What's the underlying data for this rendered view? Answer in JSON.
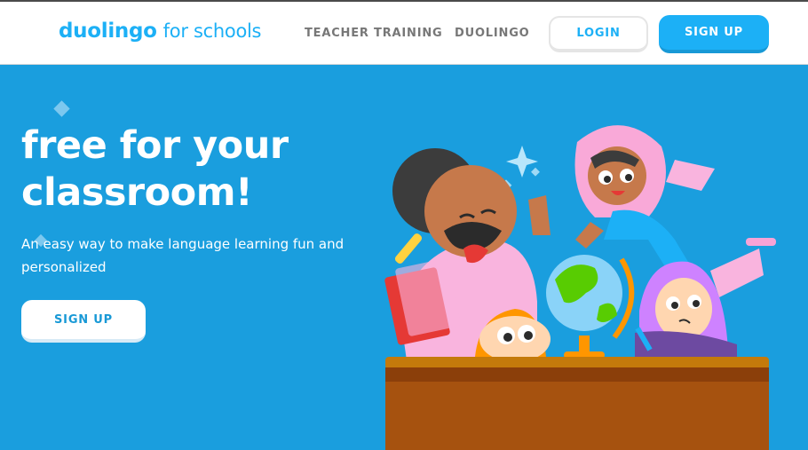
{
  "header": {
    "logo_brand": "duolingo",
    "logo_suffix": "for schools",
    "nav": [
      {
        "label": "TEACHER TRAINING"
      },
      {
        "label": "DUOLINGO"
      }
    ],
    "login_label": "LOGIN",
    "signup_label": "SIGN UP"
  },
  "hero": {
    "title_line1": "free for your",
    "title_line2": "classroom!",
    "subtitle": "An easy way to make language learning fun and personalized",
    "cta_label": "SIGN UP"
  },
  "colors": {
    "brand_blue": "#1cb0f6",
    "hero_bg": "#1a9ede",
    "nav_gray": "#777777"
  },
  "illustration": {
    "icons": [
      "teacher-character-icon",
      "hijab-student-icon",
      "globe-icon",
      "purple-hair-student-icon",
      "orange-hair-student-icon",
      "desk-icon",
      "book-stack-icon",
      "pencil-icon"
    ]
  }
}
